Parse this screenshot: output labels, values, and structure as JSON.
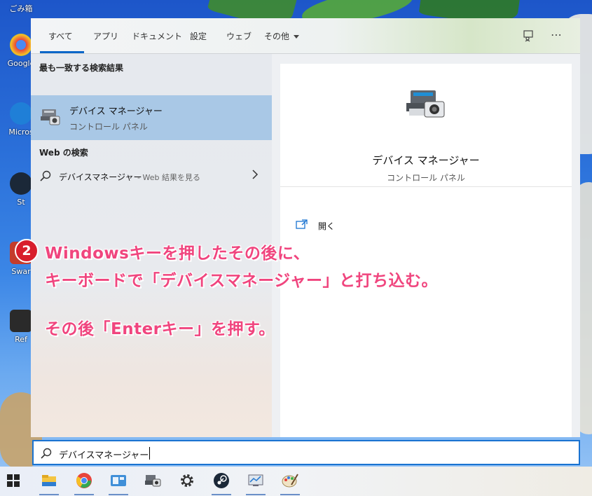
{
  "desktop": {
    "icons": [
      {
        "label": "ごみ箱",
        "color": "#b7c9d9"
      },
      {
        "label": "Google",
        "color": "#e8453c"
      },
      {
        "label": "Micros",
        "color": "#1f7fd7"
      },
      {
        "label": "St",
        "color": "#1b2838"
      },
      {
        "label": "Swar",
        "color": "#c43c2c"
      },
      {
        "label": "Ref",
        "color": "#2a2a2a"
      }
    ]
  },
  "search": {
    "tabs": [
      {
        "label": "すべて"
      },
      {
        "label": "アプリ"
      },
      {
        "label": "ドキュメント"
      },
      {
        "label": "設定"
      },
      {
        "label": "ウェブ"
      },
      {
        "label": "その他"
      }
    ],
    "best_match_heading": "最も一致する検索結果",
    "best_match": {
      "title": "デバイス マネージャー",
      "subtitle": "コントロール パネル"
    },
    "web_heading": "Web の検索",
    "web_result": {
      "query": "デバイスマネージャー",
      "suffix": " - Web 結果を見る"
    },
    "preview": {
      "title": "デバイス マネージャー",
      "subtitle": "コントロール パネル",
      "action_open": "開く"
    },
    "input_value": "デバイスマネージャー"
  },
  "annotation": {
    "badge": "2",
    "line1": "Windowsキーを押したその後に、",
    "line2": "キーボードで「デバイスマネージャー」と打ち込む。",
    "line3": "その後「Enterキー」を押す。"
  },
  "taskbar": {
    "icons": [
      "start-icon",
      "file-explorer-icon",
      "chrome-icon",
      "control-panel-icon",
      "device-manager-icon",
      "settings-icon",
      "steam-icon",
      "device-settings-icon",
      "paint-icon"
    ]
  },
  "colors": {
    "accent": "#0a66c8",
    "selection": "#a9c8e6",
    "annotation_text": "#f0457e",
    "badge": "#d81e2c"
  }
}
